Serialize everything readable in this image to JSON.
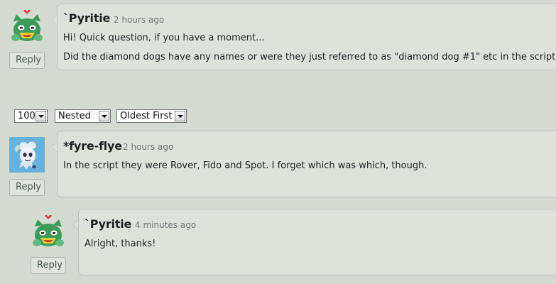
{
  "comments": [
    {
      "author": "`Pyritie",
      "time": "2 hours ago",
      "lines": [
        "Hi! Quick question, if you have a moment...",
        "Did the diamond dogs have any names or were they just referred to as \"diamond dog #1\" etc in the scripts?"
      ],
      "reply_label": "Reply",
      "avatar": "green-cat-avatar-icon"
    },
    {
      "author": "*fyre-flye",
      "time": "2 hours ago",
      "lines": [
        "In the script they were Rover, Fido and Spot. I forget which was which, though."
      ],
      "reply_label": "Reply",
      "avatar": "blue-ghost-avatar-icon"
    },
    {
      "author": "`Pyritie",
      "time": "4 minutes ago",
      "lines": [
        "Alright, thanks!"
      ],
      "reply_label": "Reply",
      "avatar": "green-cat-avatar-icon"
    }
  ],
  "controls": {
    "per_page": "100",
    "view_mode": "Nested",
    "sort_order": "Oldest First"
  },
  "colors": {
    "background": "#d4dcd1",
    "card": "#dce4da",
    "avatar_blue": "#66b2dd",
    "avatar_green": "#3c9a5a"
  }
}
